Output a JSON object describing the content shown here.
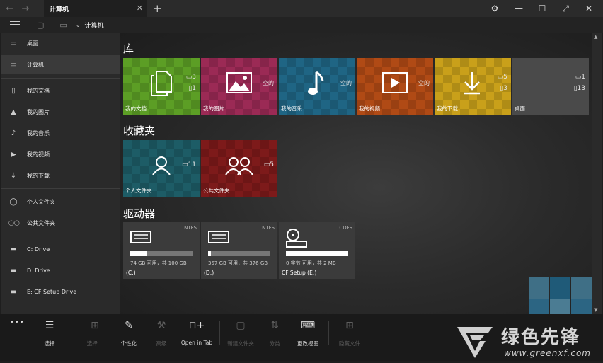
{
  "titlebar": {
    "tab_title": "计算机",
    "tab_close": "✕",
    "new_tab": "+",
    "back": "←",
    "forward": "→"
  },
  "window": {
    "settings": "⚙",
    "minimize": "—",
    "maximize": "☐",
    "fullscreen": "⤢",
    "close": "✕"
  },
  "toolbar": {
    "breadcrumb": "计算机"
  },
  "sidebar": {
    "items": [
      {
        "label": "桌面",
        "icon": "folder-icon",
        "glyph": "▭",
        "selected": false
      },
      {
        "label": "计算机",
        "icon": "computer-icon",
        "glyph": "▭",
        "selected": true
      },
      {
        "label": "我的文档",
        "icon": "document-icon",
        "glyph": "▯",
        "selected": false
      },
      {
        "label": "我的图片",
        "icon": "picture-icon",
        "glyph": "▲",
        "selected": false
      },
      {
        "label": "我的音乐",
        "icon": "music-icon",
        "glyph": "♪",
        "selected": false
      },
      {
        "label": "我的视频",
        "icon": "video-icon",
        "glyph": "▶",
        "selected": false
      },
      {
        "label": "我的下载",
        "icon": "download-icon",
        "glyph": "↓",
        "selected": false
      },
      {
        "label": "个人文件夹",
        "icon": "user-icon",
        "glyph": "◯",
        "selected": false
      },
      {
        "label": "公共文件夹",
        "icon": "users-icon",
        "glyph": "◯◯",
        "selected": false
      },
      {
        "label": "C:  Drive",
        "icon": "drive-icon",
        "glyph": "▬",
        "selected": false
      },
      {
        "label": "D:  Drive",
        "icon": "drive-icon",
        "glyph": "▬",
        "selected": false
      },
      {
        "label": "E: CF Setup Drive",
        "icon": "drive-icon",
        "glyph": "▬",
        "selected": false
      }
    ]
  },
  "sections": {
    "libraries": "库",
    "favorites": "收藏夹",
    "drives": "驱动器"
  },
  "library_tiles": [
    {
      "label": "我的文档",
      "color": "#5c9e25",
      "icon": "documents-icon",
      "folders": "3",
      "files": "1"
    },
    {
      "label": "我的图片",
      "color": "#9b2a55",
      "icon": "pictures-icon",
      "empty": "空的"
    },
    {
      "label": "我的音乐",
      "color": "#1f6584",
      "icon": "music-note-icon",
      "empty": "空的"
    },
    {
      "label": "我的视频",
      "color": "#b04a15",
      "icon": "video-play-icon",
      "empty": "空的"
    },
    {
      "label": "我的下载",
      "color": "#c9a01a",
      "icon": "download-arrow-icon",
      "folders": "5",
      "files": "3"
    },
    {
      "label": "桌面",
      "color": "#4a4a4a",
      "icon": "desktop-icon",
      "folders": "1",
      "files": "13"
    }
  ],
  "favorite_tiles": [
    {
      "label": "个人文件夹",
      "color": "#1d5c66",
      "icon": "user-icon",
      "folders": "11"
    },
    {
      "label": "公共文件夹",
      "color": "#7d1a1a",
      "icon": "users-icon",
      "folders": "5"
    }
  ],
  "drives": [
    {
      "fs": "NTFS",
      "capacity": "74 GB 可用，共 100 GB",
      "name": "(C:)",
      "used_fraction": 0.26,
      "icon": "hard-drive-icon"
    },
    {
      "fs": "NTFS",
      "capacity": "357 GB 可用，共 376 GB",
      "name": "(D:)",
      "used_fraction": 0.05,
      "icon": "hard-drive-icon"
    },
    {
      "fs": "CDFS",
      "capacity": "0 字节 可用，共 2 MB",
      "name": "CF Setup (E:)",
      "used_fraction": 1.0,
      "icon": "disc-drive-icon"
    }
  ],
  "commands": [
    {
      "label": "选择",
      "glyph": "☰",
      "name": "select-command",
      "enabled": true
    },
    {
      "label": "选择…",
      "glyph": "⊞",
      "name": "select-more-command",
      "enabled": false
    },
    {
      "label": "个性化",
      "glyph": "✎",
      "name": "personalize-command",
      "enabled": true
    },
    {
      "label": "高级",
      "glyph": "⚒",
      "name": "advanced-command",
      "enabled": false
    },
    {
      "label": "Open in Tab",
      "glyph": "⊓+",
      "name": "open-in-tab-command",
      "enabled": true
    },
    {
      "label": "新建文件夹",
      "glyph": "▢",
      "name": "new-folder-command",
      "enabled": false
    },
    {
      "label": "分类",
      "glyph": "⇅",
      "name": "sort-command",
      "enabled": false
    },
    {
      "label": "更改视图",
      "glyph": "⌨",
      "name": "change-view-command",
      "enabled": true
    },
    {
      "label": "隐藏文件",
      "glyph": "⊞",
      "name": "hide-files-command",
      "enabled": false
    }
  ],
  "more": "•••",
  "watermark": {
    "cn": "绿色先锋",
    "url": "www.greenxf.com"
  }
}
